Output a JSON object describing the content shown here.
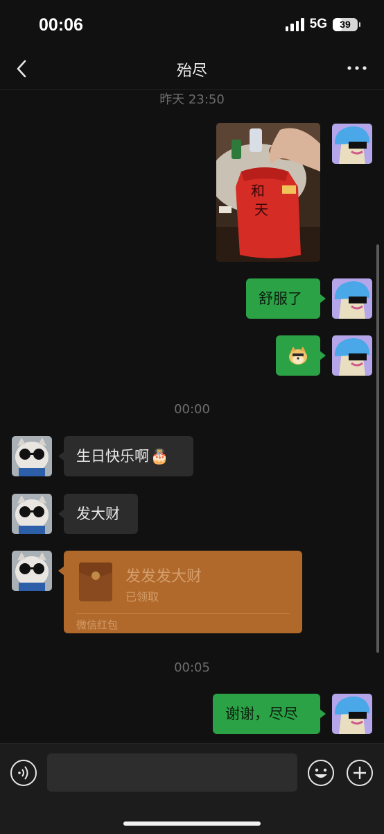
{
  "status_bar": {
    "time": "00:06",
    "network": "5G",
    "battery_level": "39",
    "signal_icon": "cellular-signal-icon",
    "battery_icon": "battery-icon"
  },
  "nav": {
    "title": "殆尽",
    "back_icon": "chevron-left-icon",
    "more_icon": "more-dots-icon"
  },
  "messages": {
    "timestamp_1": "昨天 23:50",
    "sent_photo_icon": "chat-photo-image",
    "sent_text_1": "舒服了",
    "sent_sticker_icon": "doge-emoji-icon",
    "timestamp_2": "00:00",
    "received_text_1": "生日快乐啊",
    "received_text_1_emoji": "🎂",
    "received_text_2": "发大财",
    "red_packet": {
      "title": "发发发大财",
      "status": "已领取",
      "footer": "微信红包",
      "icon": "red-packet-icon"
    },
    "timestamp_3": "00:05",
    "sent_text_2": "谢谢，尽尽"
  },
  "input_bar": {
    "voice_icon": "voice-input-icon",
    "emoji_icon": "emoji-face-icon",
    "plus_icon": "plus-circle-icon",
    "placeholder": ""
  },
  "colors": {
    "background": "#111111",
    "sent_bubble": "#2ba245",
    "received_bubble": "#2c2c2c",
    "red_packet": "#b0692b"
  }
}
